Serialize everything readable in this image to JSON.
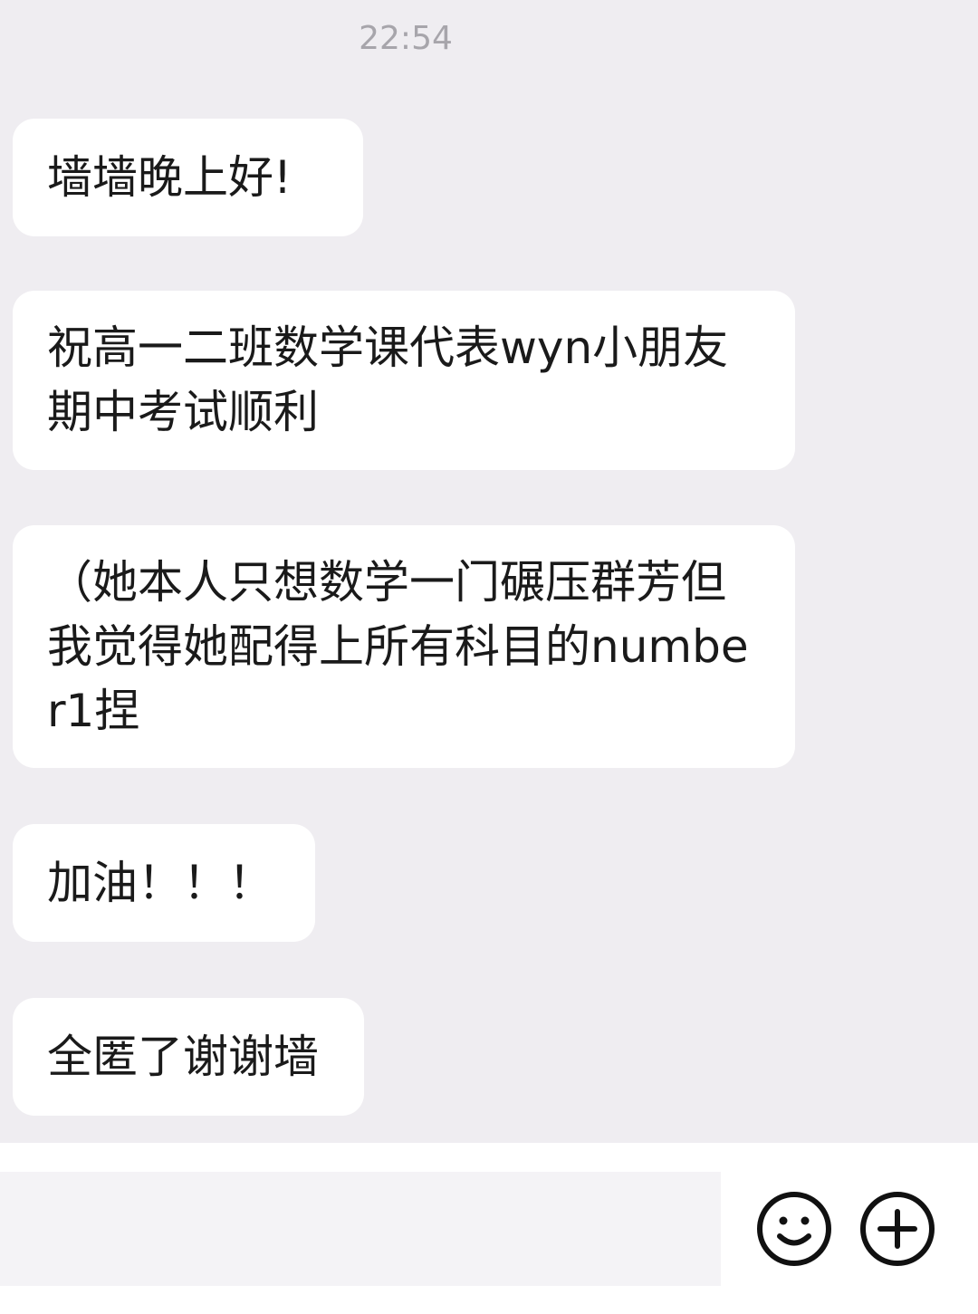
{
  "header": {
    "timestamp": "22:54"
  },
  "messages": [
    {
      "text": "墙墙晚上好!"
    },
    {
      "text": "祝高一二班数学课代表wyn小朋友期中考试顺利"
    },
    {
      "text": "（她本人只想数学一门碾压群芳但我觉得她配得上所有科目的number1捏"
    },
    {
      "text": "加油！！！"
    },
    {
      "text": "全匿了谢谢墙"
    }
  ],
  "input_bar": {
    "placeholder": "",
    "value": "",
    "icons": [
      "smiley-icon",
      "plus-icon"
    ]
  },
  "colors": {
    "background": "#efedf1",
    "bubble": "#ffffff",
    "timestamp": "#a7a5ab",
    "text": "#1a1a1a",
    "icon": "#111111"
  }
}
